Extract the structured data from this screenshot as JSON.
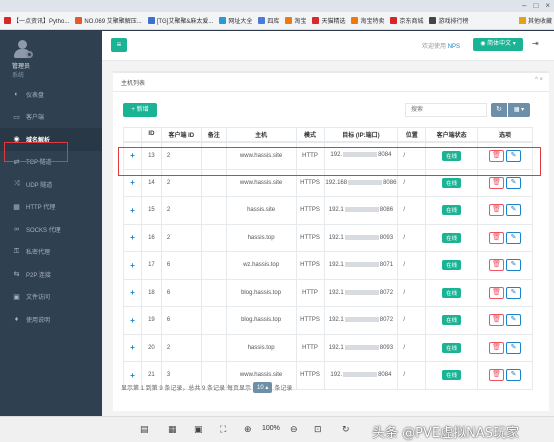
{
  "browser": {
    "bookmarks": [
      {
        "label": "【一点资讯】Pytho...",
        "color": "#d9262a"
      },
      {
        "label": "NO.069 艾聚聚解压...",
        "color": "#e55a28"
      },
      {
        "label": "[TG]艾聚聚&麻太爱...",
        "color": "#3a73c9"
      },
      {
        "label": "网址大全",
        "color": "#2a9ad6"
      },
      {
        "label": "四库",
        "color": "#4b7ad8"
      },
      {
        "label": "淘宝",
        "color": "#f0780f"
      },
      {
        "label": "天猫精选",
        "color": "#d72a2a"
      },
      {
        "label": "淘宝特卖",
        "color": "#f0780f"
      },
      {
        "label": "京东商城",
        "color": "#d7262a"
      },
      {
        "label": "游戏排行榜",
        "color": "#444444"
      }
    ],
    "bookmark_more": "其他收藏"
  },
  "sidebar": {
    "user_name": "管理员",
    "user_role": "系统",
    "items": [
      {
        "label": "仪表盘",
        "icon": "dashboard-icon",
        "glyph": "◐"
      },
      {
        "label": "客户端",
        "icon": "monitor-icon",
        "glyph": "▭"
      },
      {
        "label": "域名解析",
        "icon": "globe-icon",
        "glyph": "◉",
        "active": true
      },
      {
        "label": "TCP 隧道",
        "icon": "exchange-icon",
        "glyph": "⇄"
      },
      {
        "label": "UDP 隧道",
        "icon": "share-icon",
        "glyph": "⤨"
      },
      {
        "label": "HTTP 代理",
        "icon": "table-icon",
        "glyph": "▦"
      },
      {
        "label": "SOCKS 代理",
        "icon": "link-icon",
        "glyph": "∞"
      },
      {
        "label": "私密代理",
        "icon": "key-icon",
        "glyph": "⚿"
      },
      {
        "label": "P2P 连接",
        "icon": "p2p-icon",
        "glyph": "⇆"
      },
      {
        "label": "文件访问",
        "icon": "folder-icon",
        "glyph": "▣"
      },
      {
        "label": "使用说明",
        "icon": "lightbulb-icon",
        "glyph": "♦"
      }
    ]
  },
  "topbar": {
    "menu_glyph": "≡",
    "welcome": "欢迎使用",
    "app": "NPS",
    "lang": "◉ 简体中文 ▾",
    "logout_glyph": "⇥"
  },
  "panel": {
    "title": "主机列表",
    "tools": "^ ×",
    "add_label": "+ 新增",
    "search_placeholder": "搜索",
    "refresh_glyph": "↻",
    "cols_glyph": "▦ ▾"
  },
  "table": {
    "headers": [
      "",
      "ID",
      "客户端 ID",
      "备注",
      "主机",
      "模式",
      "目标 (IP:端口)",
      "位置",
      "客户端状态",
      "选项"
    ],
    "rows": [
      {
        "id": "13",
        "client": "2",
        "remark": "",
        "host": "www.hassis.site",
        "mode": "HTTP",
        "target_pre": "192.",
        "target_post": "8084",
        "loc": "/",
        "status": "在线"
      },
      {
        "id": "14",
        "client": "2",
        "remark": "",
        "host": "www.hassis.site",
        "mode": "HTTPS",
        "target_pre": "192.168",
        "target_post": "8086",
        "loc": "/",
        "status": "在线"
      },
      {
        "id": "15",
        "client": "2",
        "remark": "",
        "host": "hassis.site",
        "mode": "HTTPS",
        "target_pre": "192.1",
        "target_post": "8086",
        "loc": "/",
        "status": "在线"
      },
      {
        "id": "16",
        "client": "2",
        "remark": "",
        "host": "hassis.top",
        "mode": "HTTPS",
        "target_pre": "192.1",
        "target_post": "8093",
        "loc": "/",
        "status": "在线"
      },
      {
        "id": "17",
        "client": "6",
        "remark": "",
        "host": "wz.hassis.top",
        "mode": "HTTPS",
        "target_pre": "192.1",
        "target_post": "8071",
        "loc": "/",
        "status": "在线"
      },
      {
        "id": "18",
        "client": "6",
        "remark": "",
        "host": "blog.hassis.top",
        "mode": "HTTP",
        "target_pre": "192.1",
        "target_post": "8072",
        "loc": "/",
        "status": "在线"
      },
      {
        "id": "19",
        "client": "6",
        "remark": "",
        "host": "blog.hassis.top",
        "mode": "HTTPS",
        "target_pre": "192.1",
        "target_post": "8072",
        "loc": "/",
        "status": "在线"
      },
      {
        "id": "20",
        "client": "2",
        "remark": "",
        "host": "hassis.top",
        "mode": "HTTP",
        "target_pre": "192.1",
        "target_post": "8093",
        "loc": "/",
        "status": "在线"
      },
      {
        "id": "21",
        "client": "3",
        "remark": "",
        "host": "www.hassis.site",
        "mode": "HTTPS",
        "target_pre": "192.",
        "target_post": "8084",
        "loc": "/",
        "status": "在线"
      }
    ],
    "expand_glyph": "+",
    "delete_glyph": "🗑",
    "edit_glyph": "✎"
  },
  "pagination": {
    "info": "显示第 1 到第 9 条记录，总共 9 条记录",
    "per_page_prefix": "每页显示",
    "page_size": "10 ▴",
    "per_page_suffix": "条记录"
  },
  "viewer": {
    "zoom": "100%",
    "watermark": "头条 @PVE虚拟NAS玩家"
  }
}
